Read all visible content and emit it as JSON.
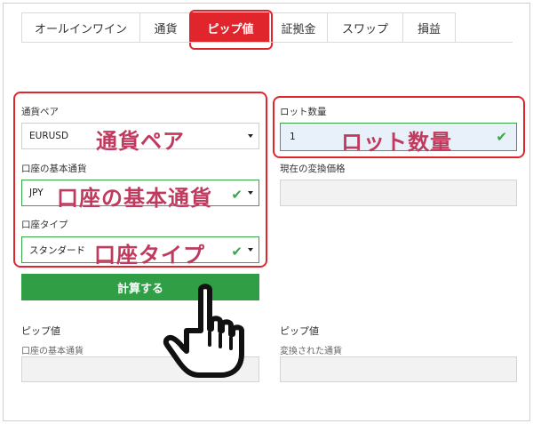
{
  "tabs": [
    {
      "label": "オールインワイン"
    },
    {
      "label": "通貨"
    },
    {
      "label": "ピップ値"
    },
    {
      "label": "証拠金"
    },
    {
      "label": "スワップ"
    },
    {
      "label": "損益"
    }
  ],
  "form": {
    "pair_label": "通貨ペア",
    "pair_value": "EURUSD",
    "base_currency_label": "口座の基本通貨",
    "base_currency_value": "JPY",
    "account_type_label": "口座タイプ",
    "account_type_value": "スタンダード",
    "lot_label": "ロット数量",
    "lot_value": "1",
    "rate_label": "現在の変換価格",
    "calculate_button": "計算する"
  },
  "annotations": {
    "pair": "通貨ペア",
    "base_currency": "口座の基本通貨",
    "account_type": "口座タイプ",
    "lot": "ロット数量"
  },
  "results": {
    "left_title": "ピップ値",
    "left_sub": "口座の基本通貨",
    "right_title": "ピップ値",
    "right_sub": "変換された通貨"
  },
  "colors": {
    "active_tab": "#e0262c",
    "button": "#2f9e44",
    "valid": "#38a847",
    "annotation": "#c03a5e"
  },
  "icons": [
    "check-icon",
    "caret-down-icon",
    "pointing-hand-icon"
  ]
}
